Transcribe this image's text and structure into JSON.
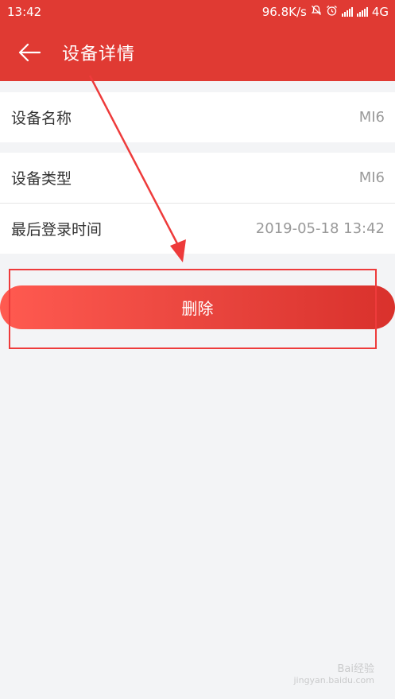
{
  "status_bar": {
    "time": "13:42",
    "net_speed": "96.8K/s",
    "network": "4G"
  },
  "header": {
    "title": "设备详情"
  },
  "details": [
    {
      "label": "设备名称",
      "value": "MI6"
    },
    {
      "label": "设备类型",
      "value": "MI6"
    },
    {
      "label": "最后登录时间",
      "value": "2019-05-18 13:42"
    }
  ],
  "actions": {
    "delete_label": "删除"
  },
  "watermark": {
    "brand": "Bai经验",
    "url": "jingyan.baidu.com"
  },
  "colors": {
    "primary": "#e03a33",
    "background": "#f3f4f6",
    "annotation": "#ee3b3b"
  }
}
